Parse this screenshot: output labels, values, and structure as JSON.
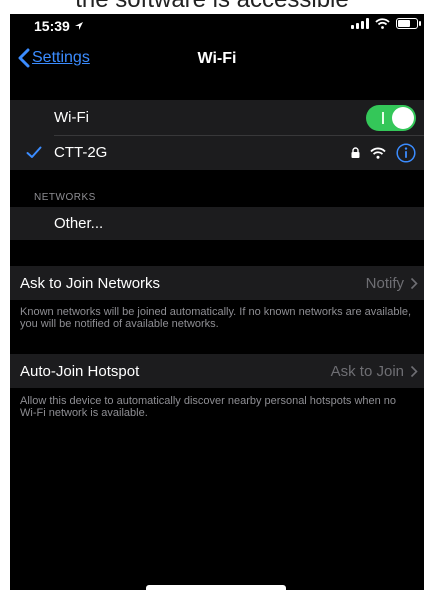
{
  "caption": "the software is accessible",
  "status_bar": {
    "time": "15:39"
  },
  "nav": {
    "back_label": "Settings",
    "title": "Wi-Fi"
  },
  "wifi": {
    "label": "Wi-Fi",
    "enabled": true,
    "connected_network": "CTT-2G"
  },
  "networks": {
    "header": "NETWORKS",
    "other_label": "Other..."
  },
  "ask_to_join": {
    "label": "Ask to Join Networks",
    "value": "Notify",
    "description": "Known networks will be joined automatically. If no known networks are available, you will be notified of available networks."
  },
  "auto_join": {
    "label": "Auto-Join Hotspot",
    "value": "Ask to Join",
    "description": "Allow this device to automatically discover nearby personal hotspots when no Wi-Fi network is available."
  },
  "colors": {
    "accent": "#3b8cff",
    "toggle_on": "#34c759",
    "background": "#000000",
    "cell": "#1c1c1e"
  },
  "icons": [
    "location-arrow-icon",
    "signal-icon",
    "wifi-icon",
    "battery-icon",
    "chevron-left-icon",
    "checkmark-icon",
    "lock-icon",
    "info-icon",
    "chevron-right-icon"
  ]
}
